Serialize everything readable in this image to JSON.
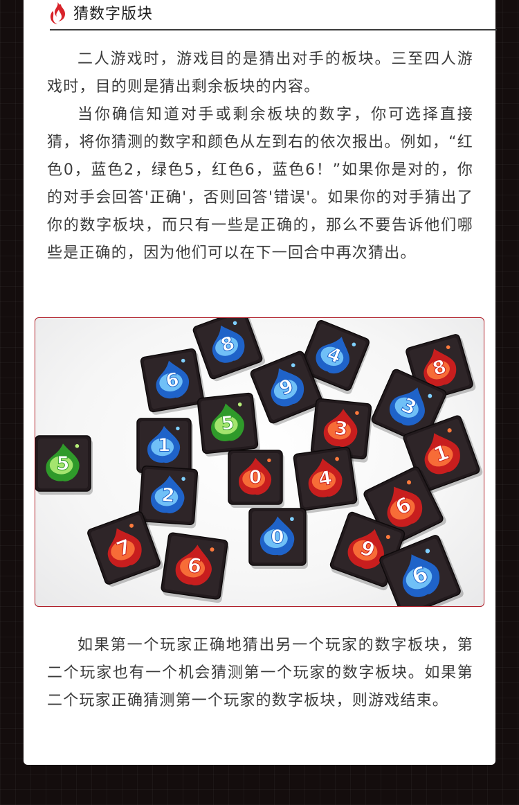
{
  "section": {
    "title": "猜数字版块",
    "icon": "flame-icon"
  },
  "paragraphs_top": [
    "二人游戏时，游戏目的是猜出对手的板块。三至四人游戏时，目的则是猜出剩余板块的内容。",
    "当你确信知道对手或剩余板块的数字，你可选择直接猜，将你猜测的数字和颜色从左到右的依次报出。例如，“红色0，蓝色2，绿色5，红色6，蓝色6！”如果你是对的，你的对手会回答'正确'，否则回答'错误'。如果你的对手猜出了你的数字板块，而只有一些是正确的，那么不要告诉他们哪些是正确的，因为他们可以在下一回合中再次猜出。"
  ],
  "paragraphs_bottom": [
    "如果第一个玩家正确地猜出另一个玩家的数字板块，第二个玩家也有一个机会猜测第一个玩家的数字板块。如果第二个玩家正确猜测第一个玩家的数字板块，则游戏结束。"
  ],
  "colors": {
    "accent_red": "#d8232a",
    "tile_red": "#e2462a",
    "tile_blue": "#2e8fe0",
    "tile_green": "#5cc23a"
  },
  "photo": {
    "tiles": [
      {
        "num": "8",
        "color": "blue"
      },
      {
        "num": "4",
        "color": "blue"
      },
      {
        "num": "8",
        "color": "red"
      },
      {
        "num": "6",
        "color": "blue"
      },
      {
        "num": "9",
        "color": "blue"
      },
      {
        "num": "3",
        "color": "blue"
      },
      {
        "num": "5",
        "color": "green"
      },
      {
        "num": "3",
        "color": "red"
      },
      {
        "num": "1",
        "color": "blue"
      },
      {
        "num": "5",
        "color": "green"
      },
      {
        "num": "1",
        "color": "red"
      },
      {
        "num": "0",
        "color": "red"
      },
      {
        "num": "4",
        "color": "red"
      },
      {
        "num": "2",
        "color": "blue"
      },
      {
        "num": "6",
        "color": "red"
      },
      {
        "num": "7",
        "color": "red"
      },
      {
        "num": "0",
        "color": "blue"
      },
      {
        "num": "9",
        "color": "red"
      },
      {
        "num": "6",
        "color": "red"
      },
      {
        "num": "6",
        "color": "blue"
      }
    ]
  }
}
